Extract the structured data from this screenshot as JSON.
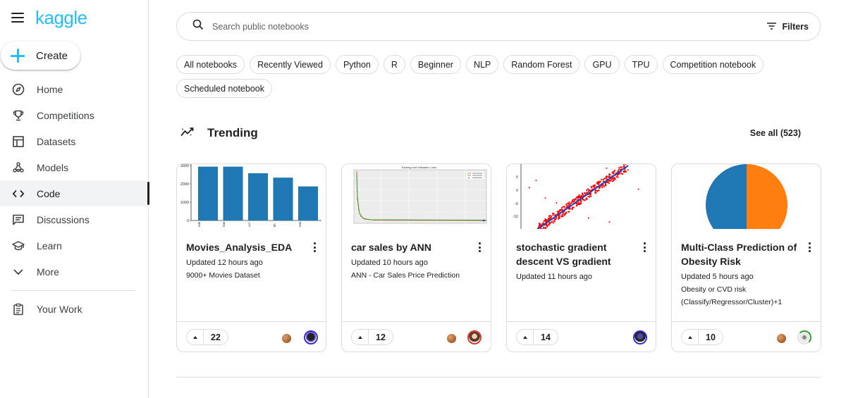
{
  "app": {
    "logo": "kaggle"
  },
  "sidebar": {
    "create_label": "Create",
    "items": [
      {
        "label": "Home",
        "icon": "compass-icon"
      },
      {
        "label": "Competitions",
        "icon": "trophy-icon"
      },
      {
        "label": "Datasets",
        "icon": "table-icon"
      },
      {
        "label": "Models",
        "icon": "models-icon"
      },
      {
        "label": "Code",
        "icon": "code-icon",
        "active": true
      },
      {
        "label": "Discussions",
        "icon": "discussion-icon"
      },
      {
        "label": "Learn",
        "icon": "school-icon"
      },
      {
        "label": "More",
        "icon": "chevron-down-icon"
      }
    ],
    "your_work": {
      "label": "Your Work",
      "icon": "clipboard-icon"
    }
  },
  "search": {
    "placeholder": "Search public notebooks",
    "filters_label": "Filters"
  },
  "chips": [
    "All notebooks",
    "Recently Viewed",
    "Python",
    "R",
    "Beginner",
    "NLP",
    "Random Forest",
    "GPU",
    "TPU",
    "Competition notebook",
    "Scheduled notebook"
  ],
  "trending": {
    "title": "Trending",
    "see_all": "See all (523)",
    "cards": [
      {
        "title": "Movies_Analysis_EDA",
        "updated": "Updated 12 hours ago",
        "sub1": "9000+ Movies Dataset",
        "sub2": "",
        "votes": "22"
      },
      {
        "title": "car sales by ANN",
        "updated": "Updated 10 hours ago",
        "sub1": "ANN - Car Sales Price Prediction",
        "sub2": "",
        "votes": "12"
      },
      {
        "title": "stochastic gradient descent VS gradient",
        "updated": "Updated 11 hours ago",
        "sub1": "",
        "sub2": "",
        "votes": "14"
      },
      {
        "title": "Multi-Class Prediction of Obesity Risk",
        "updated": "Updated 5 hours ago",
        "sub1": "Obesity or CVD risk",
        "sub2": "(Classify/Regressor/Cluster)+1",
        "votes": "10"
      }
    ]
  },
  "thumbnails": {
    "movies": {
      "y_ticks": [
        "3000",
        "2000",
        "1000",
        "0"
      ],
      "bar_levels": [
        0.98,
        0.98,
        0.86,
        0.78,
        0.62
      ],
      "bar_color": "#1f77b4"
    },
    "car_sales": {
      "title": "Training and Validation Loss"
    },
    "sgd": {
      "y_ticks": [
        "5",
        "0",
        "-5",
        "-10"
      ],
      "point_color": "#ff0000",
      "line_color": "#1f3fbf"
    },
    "obesity": {
      "colors": [
        "#1f77b4",
        "#ff7f0e"
      ],
      "shares": [
        0.5,
        0.5
      ]
    }
  },
  "colors": {
    "accent": "#20beff",
    "border": "#dadce0",
    "active_bg": "#f1f3f4"
  }
}
